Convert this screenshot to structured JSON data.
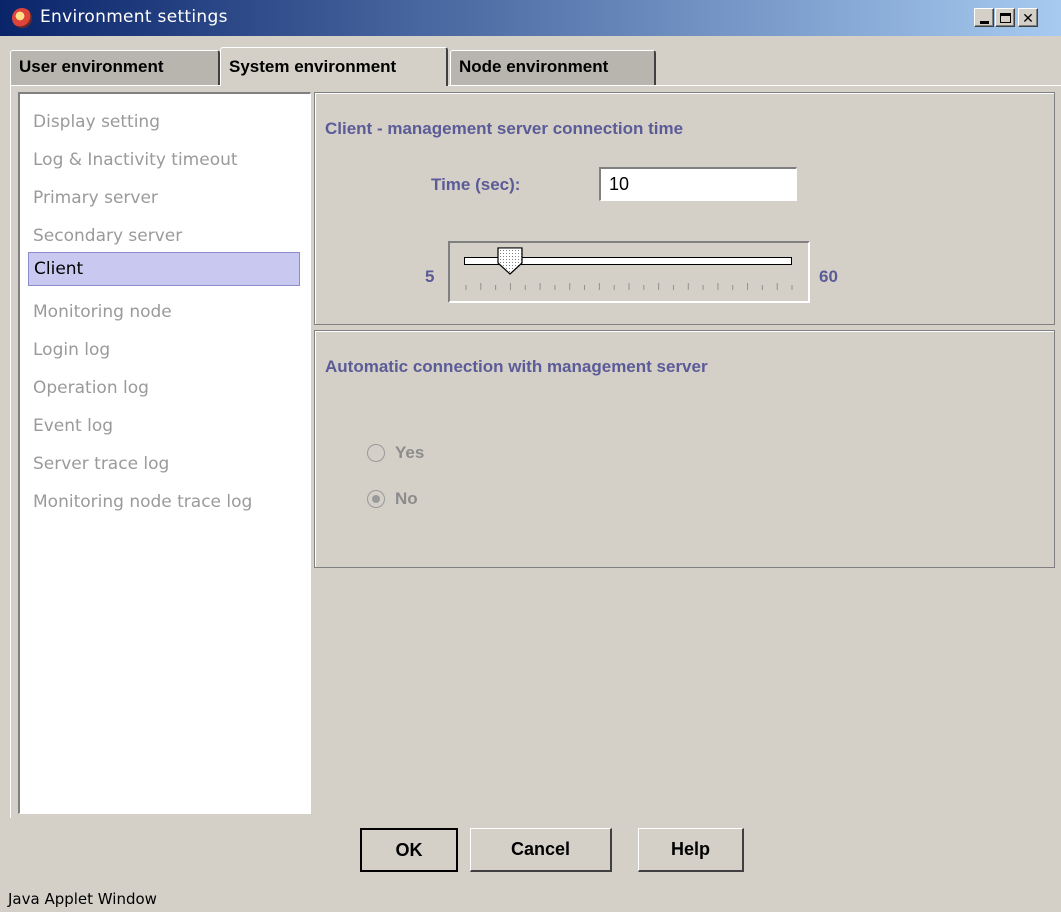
{
  "window": {
    "title": "Environment settings",
    "icon": "environment-settings-app-icon"
  },
  "tabs": [
    {
      "label": "User environment",
      "active": false
    },
    {
      "label": "System environment",
      "active": true
    },
    {
      "label": "Node environment",
      "active": false
    }
  ],
  "nav": {
    "selected": "Client",
    "items": [
      "Display setting",
      "Log & Inactivity timeout",
      "Primary server",
      "Secondary server",
      "Client",
      "Monitoring node",
      "Login log",
      "Operation log",
      "Event log",
      "Server trace log",
      "Monitoring node trace log"
    ]
  },
  "connection": {
    "title": "Client - management server connection time",
    "time_label": "Time (sec):",
    "time_value": "10",
    "slider_min": "5",
    "slider_max": "60",
    "slider_value": 10
  },
  "auto_connect": {
    "title": "Automatic connection with management server",
    "options": [
      "Yes",
      "No"
    ],
    "selected": "No"
  },
  "buttons": {
    "ok": "OK",
    "cancel": "Cancel",
    "help": "Help"
  },
  "status_text": "Java Applet Window",
  "colors": {
    "title_bar_start": "#0a246a",
    "title_bar_end": "#a6caf0",
    "label_color": "#5b5b98",
    "selection_bg": "#c8c8f0",
    "window_bg": "#d4d0c8"
  }
}
